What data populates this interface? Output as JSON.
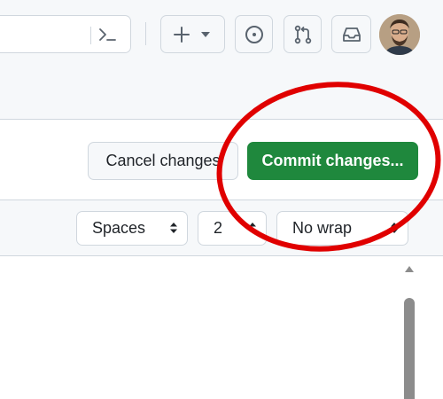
{
  "header": {
    "command_palette_icon": "terminal-icon",
    "create_icon": "plus-icon",
    "create_dropdown_icon": "triangle-down-icon",
    "issues_icon": "issue-opened-icon",
    "pull_requests_icon": "git-pull-request-icon",
    "inbox_icon": "inbox-icon",
    "avatar_alt": "user avatar"
  },
  "actions": {
    "cancel_label": "Cancel changes",
    "commit_label": "Commit changes..."
  },
  "editor_toolbar": {
    "indent_mode": "Spaces",
    "indent_size": "2",
    "wrap_mode": "No wrap"
  },
  "colors": {
    "commit_green": "#1f883d",
    "annotation_red": "#e00000",
    "chrome_bg": "#f6f8fa",
    "border": "#d0d7de"
  },
  "annotation": {
    "shape": "ellipse",
    "target": "commit-button"
  }
}
